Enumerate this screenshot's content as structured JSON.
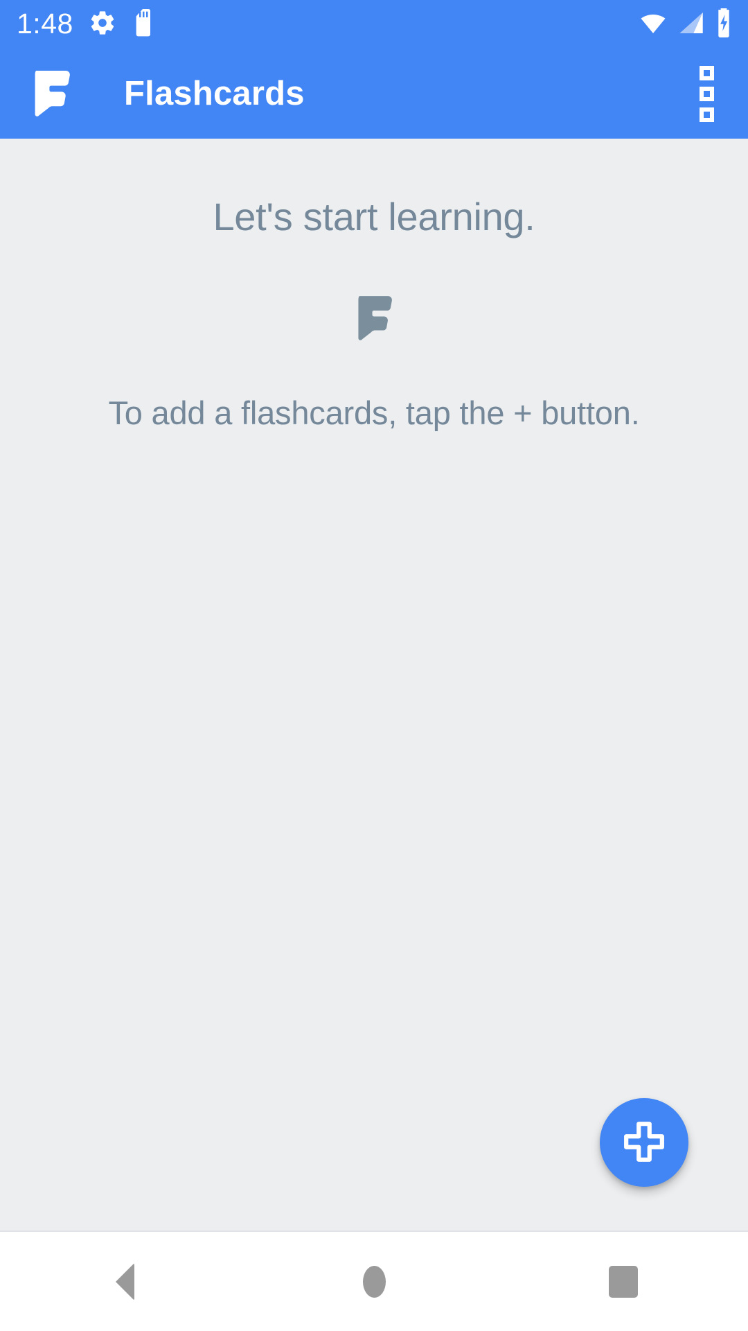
{
  "status_bar": {
    "time": "1:48",
    "left_icons": [
      "gear-icon",
      "sd-card-icon"
    ],
    "right_icons": [
      "wifi-icon",
      "cellular-signal-icon",
      "battery-charging-icon"
    ],
    "background_color": "#4285f4",
    "foreground_color": "#ffffff"
  },
  "app_bar": {
    "logo_icon": "flashcards-f-logo-icon",
    "title": "Flashcards",
    "overflow_icon": "overflow-menu-icon",
    "background_color": "#4285f4",
    "title_color": "#ffffff"
  },
  "content": {
    "background_color": "#eceef0",
    "empty_state": {
      "heading": "Let's start learning.",
      "logo_icon": "flashcards-f-logo-icon",
      "subtext": "To add a flashcards, tap the + button.",
      "text_color": "#74889a",
      "logo_color": "#7b8e9c"
    }
  },
  "fab": {
    "label": "+",
    "icon": "plus-icon",
    "accent_color": "#4285f4",
    "icon_color": "#ffffff"
  },
  "nav_bar": {
    "background_color": "#ffffff",
    "icon_color": "#9a9a9a",
    "buttons": [
      {
        "name": "back",
        "icon": "back-triangle-icon"
      },
      {
        "name": "home",
        "icon": "home-circle-icon"
      },
      {
        "name": "recents",
        "icon": "recents-square-icon"
      }
    ]
  }
}
